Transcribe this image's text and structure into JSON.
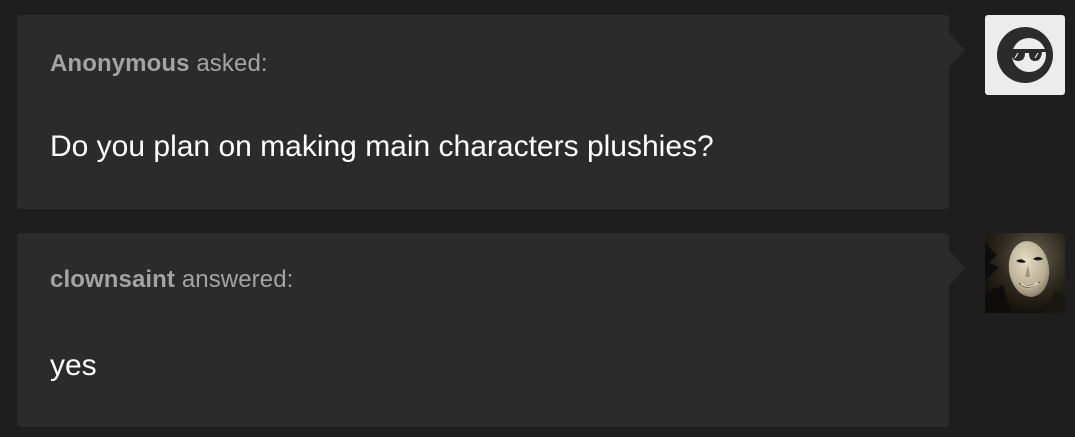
{
  "ask": {
    "asker": "Anonymous",
    "verb": "asked:",
    "question": "Do you plan on making main characters plushies?",
    "avatar_icon": "anonymous-sunglasses-icon"
  },
  "answer": {
    "answerer": "clownsaint",
    "verb": "answered:",
    "text": "yes",
    "avatar_icon": "clownsaint-mask-avatar"
  },
  "colors": {
    "page_background": "#1e1e1e",
    "card_background": "#2b2b2b",
    "attribution_text": "#a3a3a3",
    "body_text": "#ffffff"
  }
}
